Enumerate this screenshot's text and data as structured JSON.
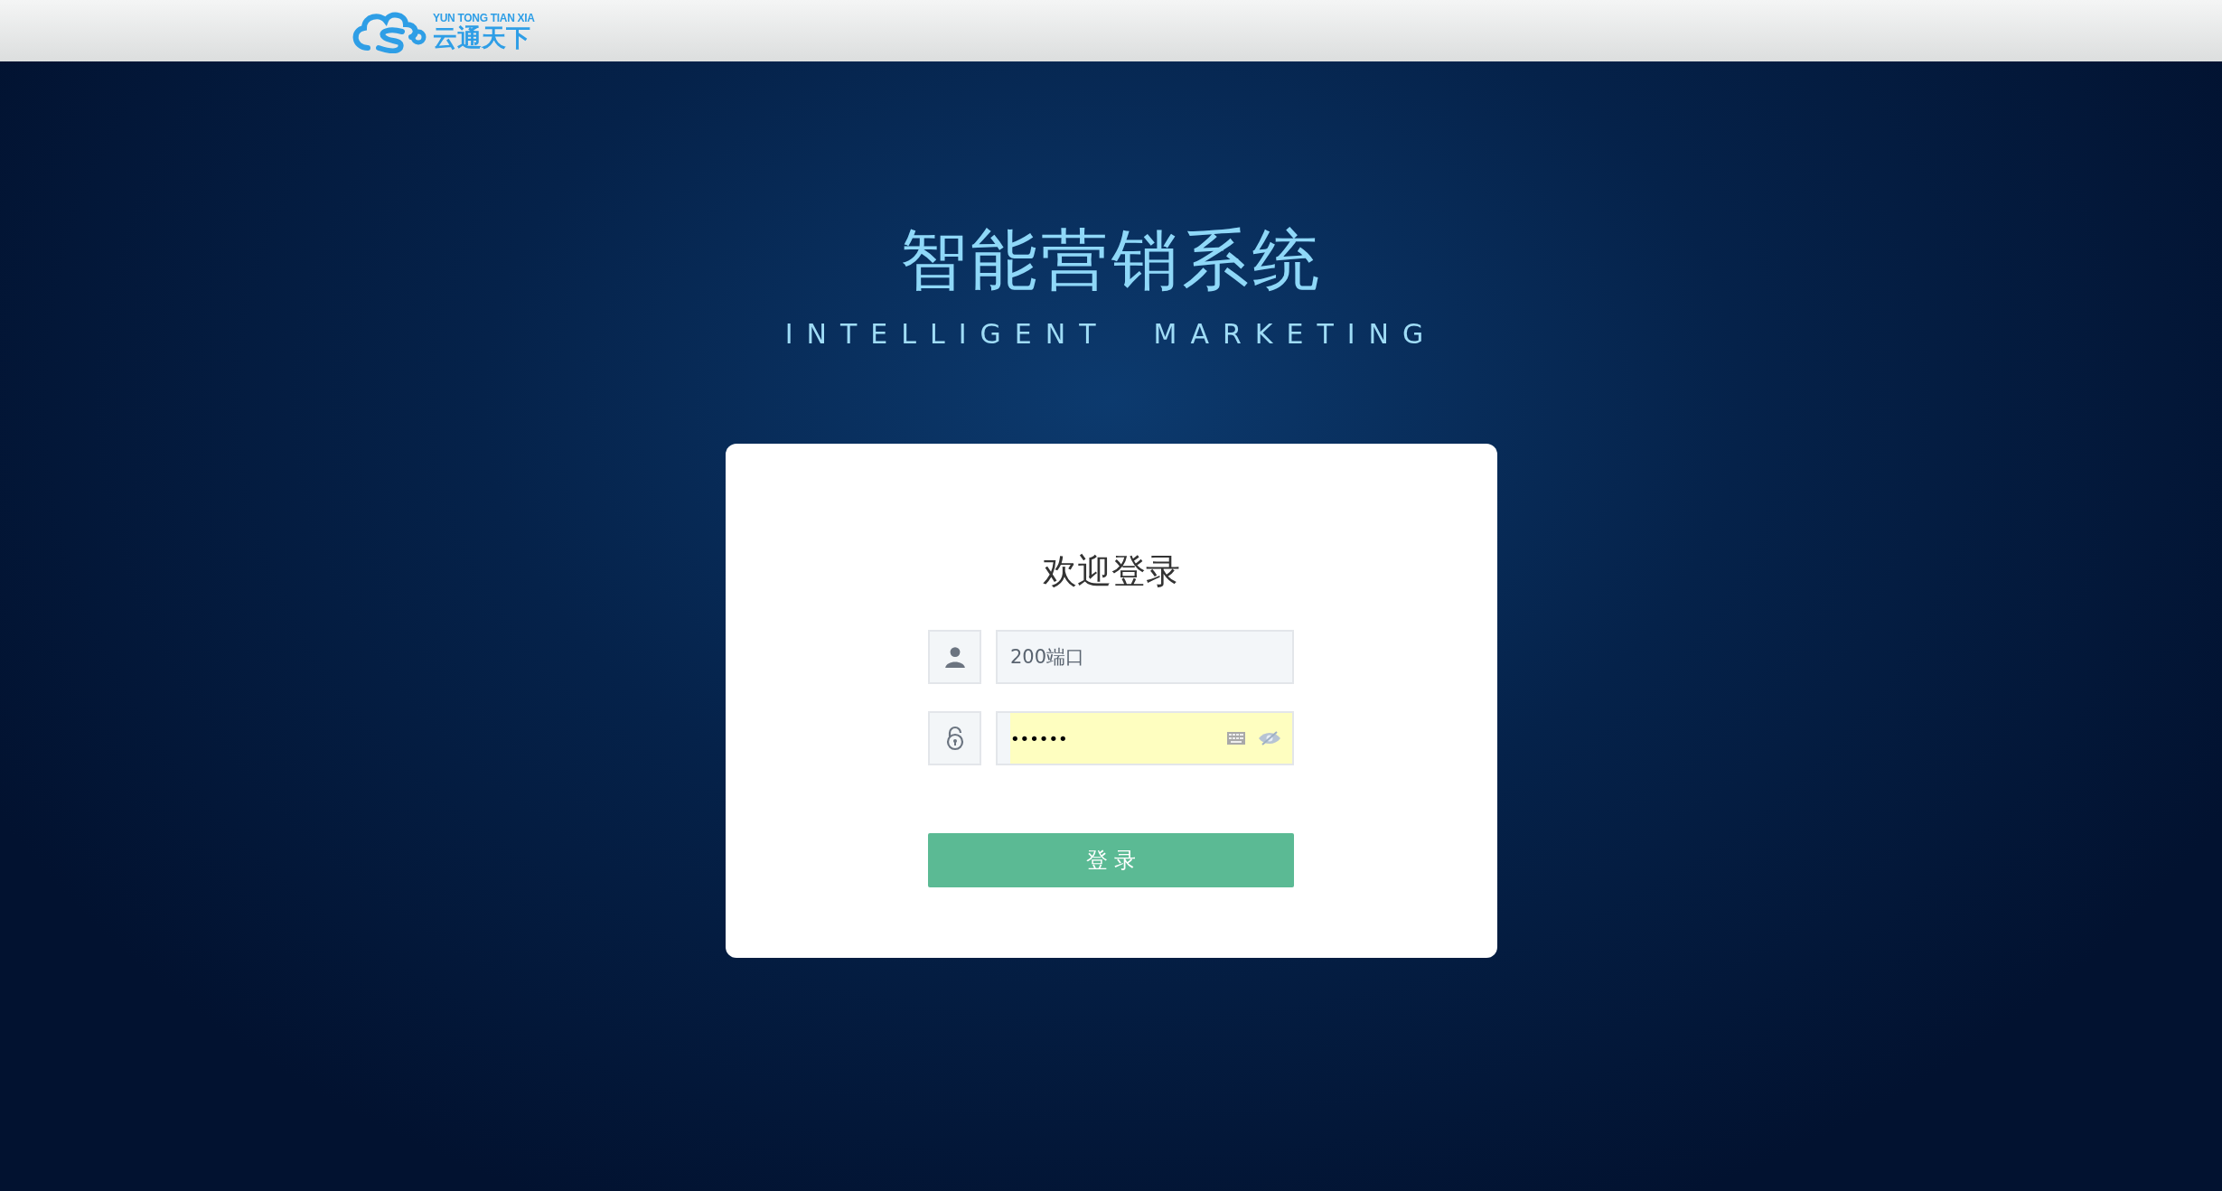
{
  "header": {
    "logo": {
      "tagline": "YUN TONG TIAN XIA",
      "name": "云通天下"
    }
  },
  "hero": {
    "title": "智能营销系统",
    "subtitle": "INTELLIGENT  MARKETING"
  },
  "login": {
    "heading": "欢迎登录",
    "fields": [
      {
        "kind": "user",
        "value": "200端口",
        "autofilled": false
      },
      {
        "kind": "password",
        "value": "••••••",
        "autofilled": true
      }
    ],
    "button": "登 录"
  }
}
